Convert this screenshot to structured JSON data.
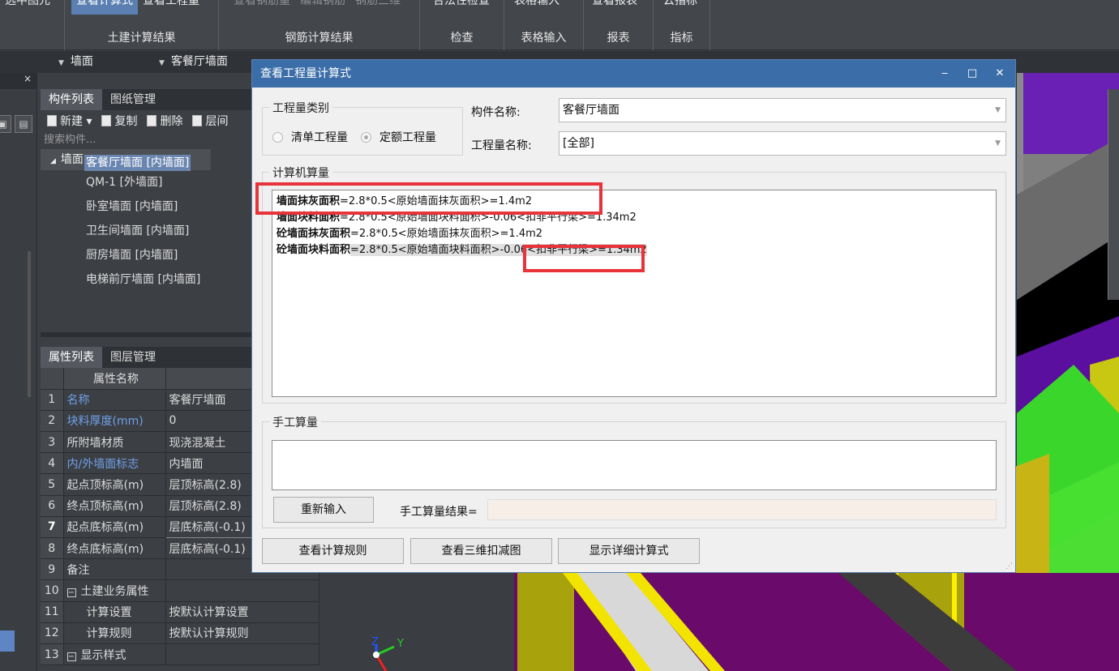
{
  "ribbon": {
    "groups": [
      {
        "buttons": [
          "选中图元"
        ],
        "label": ""
      },
      {
        "buttons": [
          "查看计算式",
          "查看工程量"
        ],
        "label": "土建计算结果"
      },
      {
        "buttons": [
          "查看钢筋量",
          "编辑钢筋",
          "钢筋三维"
        ],
        "label": "钢筋计算结果"
      },
      {
        "buttons": [
          "合法性检查"
        ],
        "label": "检查"
      },
      {
        "buttons": [
          "表格输入"
        ],
        "label": "表格输入"
      },
      {
        "buttons": [
          "查看报表"
        ],
        "label": "报表"
      },
      {
        "buttons": [
          "云指标"
        ],
        "label": "指标"
      }
    ]
  },
  "selector_bar": {
    "sel1": "墙面",
    "sel2": "客餐厅墙面"
  },
  "left_col": {
    "close": "×"
  },
  "component_panel": {
    "tabs": [
      "构件列表",
      "图纸管理"
    ],
    "toolbar": [
      "新建",
      "复制",
      "删除",
      "层间"
    ],
    "search_placeholder": "搜索构件...",
    "tree_root": "墙面",
    "items": [
      "QM-1 [外墙面]",
      "卧室墙面 [内墙面]",
      "卫生间墙面 [内墙面]",
      "厨房墙面 [内墙面]",
      "客餐厅墙面 [内墙面]",
      "电梯前厅墙面 [内墙面]"
    ],
    "selected_index": 4
  },
  "property_panel": {
    "tabs": [
      "属性列表",
      "图层管理"
    ],
    "col_name": "属性名称",
    "col_value": "属性值",
    "rows": [
      {
        "no": "1",
        "name": "名称",
        "value": "客餐厅墙面"
      },
      {
        "no": "2",
        "name": "块料厚度(mm)",
        "value": "0"
      },
      {
        "no": "3",
        "name": "所附墙材质",
        "value": "现浇混凝土"
      },
      {
        "no": "4",
        "name": "内/外墙面标志",
        "value": "内墙面"
      },
      {
        "no": "5",
        "name": "起点顶标高(m)",
        "value": "层顶标高(2.8)"
      },
      {
        "no": "6",
        "name": "终点顶标高(m)",
        "value": "层顶标高(2.8)"
      },
      {
        "no": "7",
        "name": "起点底标高(m)",
        "value": "层底标高(-0.1)"
      },
      {
        "no": "8",
        "name": "终点底标高(m)",
        "value": "层底标高(-0.1)"
      },
      {
        "no": "9",
        "name": "备注",
        "value": ""
      },
      {
        "no": "10",
        "name": "土建业务属性",
        "value": ""
      },
      {
        "no": "11",
        "name": "计算设置",
        "value": "按默认计算设置"
      },
      {
        "no": "12",
        "name": "计算规则",
        "value": "按默认计算规则"
      },
      {
        "no": "13",
        "name": "显示样式",
        "value": ""
      }
    ]
  },
  "dialog": {
    "title": "查看工程量计算式",
    "minimize": "‒",
    "maximize": "□",
    "close": "✕",
    "category_legend": "工程量类别",
    "radio_list": "清单工程量",
    "radio_quota": "定额工程量",
    "component_name_label": "构件名称:",
    "component_name_value": "客餐厅墙面",
    "quantity_name_label": "工程量名称:",
    "quantity_name_value": "[全部]",
    "computer_legend": "计算机算量",
    "lines": [
      {
        "name": "墙面抹灰面积",
        "expr": "=2.8*0.5<原始墙面抹灰面积>=1.4m2"
      },
      {
        "name": "墙面块料面积",
        "expr": "=2.8*0.5<原始墙面块料面积>-0.06<扣非平行梁>=1.34m2"
      },
      {
        "name": "砼墙面抹灰面积",
        "expr": "=2.8*0.5<原始墙面抹灰面积>=1.4m2"
      },
      {
        "name": "砼墙面块料面积",
        "expr": "=2.8*0.5<原始墙面块料面积>-0.06<扣非平行梁>=1.34m2"
      }
    ],
    "manual_legend": "手工算量",
    "reenter_button": "重新输入",
    "manual_result_label": "手工算量结果=",
    "buttons": [
      "查看计算规则",
      "查看三维扣减图",
      "显示详细计算式"
    ]
  },
  "viewport": {
    "axis_y": "Y",
    "axis_z": "Z"
  },
  "colors": {
    "dialog_title": "#3b6ea8",
    "highlight_red": "#e8333a",
    "selection": "#6a86b0"
  }
}
